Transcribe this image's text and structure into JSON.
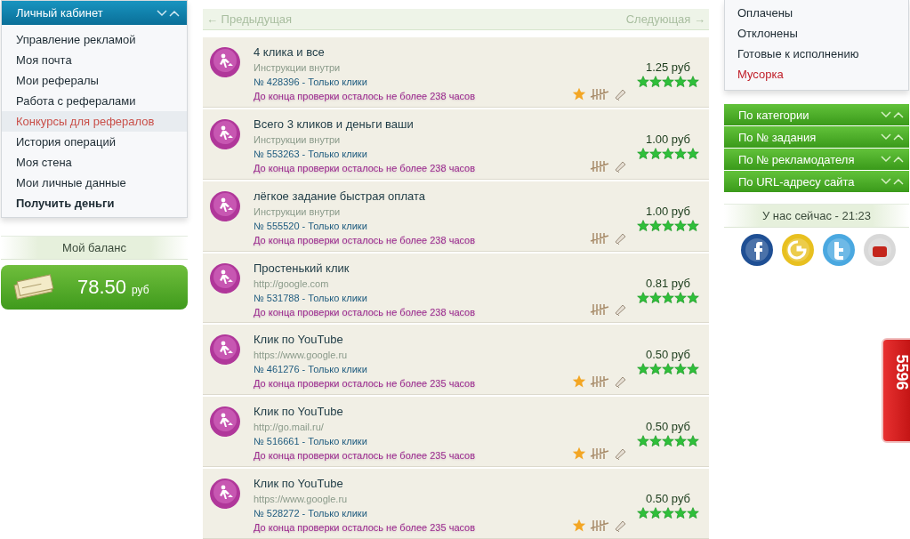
{
  "account_menu": {
    "title": "Личный кабинет",
    "items": [
      {
        "label": "Управление рекламой",
        "selected": false,
        "kind": "link"
      },
      {
        "label": "Моя почта",
        "selected": false,
        "kind": "link"
      },
      {
        "label": "Мои рефералы",
        "selected": false,
        "kind": "link"
      },
      {
        "label": "Работа с рефералами",
        "selected": false,
        "kind": "link"
      },
      {
        "label": "Конкурсы для рефералов",
        "selected": true,
        "kind": "link"
      },
      {
        "label": "История операций",
        "selected": false,
        "kind": "link"
      },
      {
        "label": "Моя стена",
        "selected": false,
        "kind": "link"
      },
      {
        "label": "Мои личные данные",
        "selected": false,
        "kind": "link"
      },
      {
        "label": "Получить деньги",
        "selected": false,
        "kind": "strong"
      }
    ]
  },
  "balance": {
    "title": "Мой баланс",
    "amount": "78.50",
    "currency": "руб"
  },
  "pager": {
    "previous": "← Предыдущая",
    "next": "Следующая →"
  },
  "tasks": [
    {
      "title": "4 клика и все",
      "subtitle": "Инструкции внутри",
      "number": "№ 428396 - Только клики",
      "deadline": "До конца проверки осталось не более 238 часов",
      "price": "1.25 руб",
      "stars": 5,
      "favorite": true
    },
    {
      "title": "Всего 3 кликов и деньги ваши",
      "subtitle": "Инструкции внутри",
      "number": "№ 553263 - Только клики",
      "deadline": "До конца проверки осталось не более 238 часов",
      "price": "1.00 руб",
      "stars": 5,
      "favorite": false
    },
    {
      "title": "лёгкое задание быстрая оплата",
      "subtitle": "Инструкции внутри",
      "number": "№ 555520 - Только клики",
      "deadline": "До конца проверки осталось не более 238 часов",
      "price": "1.00 руб",
      "stars": 5,
      "favorite": false
    },
    {
      "title": "Простенький клик",
      "subtitle": "http://google.com",
      "number": "№ 531788 - Только клики",
      "deadline": "До конца проверки осталось не более 238 часов",
      "price": "0.81 руб",
      "stars": 5,
      "favorite": false
    },
    {
      "title": "Клик по YouTube",
      "subtitle": "https://www.google.ru",
      "number": "№ 461276 - Только клики",
      "deadline": "До конца проверки осталось не более 235 часов",
      "price": "0.50 руб",
      "stars": 5,
      "favorite": true
    },
    {
      "title": "Клик по YouTube",
      "subtitle": "http://go.mail.ru/",
      "number": "№ 516661 - Только клики",
      "deadline": "До конца проверки осталось не более 235 часов",
      "price": "0.50 руб",
      "stars": 5,
      "favorite": true
    },
    {
      "title": "Клик по YouTube",
      "subtitle": "https://www.google.ru",
      "number": "№ 528272 - Только клики",
      "deadline": "До конца проверки осталось не более 235 часов",
      "price": "0.50 руб",
      "stars": 5,
      "favorite": true
    }
  ],
  "status_menu": {
    "items": [
      {
        "label": "Оплачены",
        "selected": false
      },
      {
        "label": "Отклонены",
        "selected": false
      },
      {
        "label": "Готовые к исполнению",
        "selected": false
      },
      {
        "label": "Мусорка",
        "selected": true
      }
    ]
  },
  "filters": [
    "По категории",
    "По № задания",
    "По № рекламодателя",
    "По URL-адресу сайта"
  ],
  "clock": "У нас сейчас - 21:23",
  "social": [
    {
      "kind": "facebook"
    },
    {
      "kind": "google"
    },
    {
      "kind": "twitter"
    },
    {
      "kind": "youtube"
    }
  ],
  "side_badge": "5596"
}
